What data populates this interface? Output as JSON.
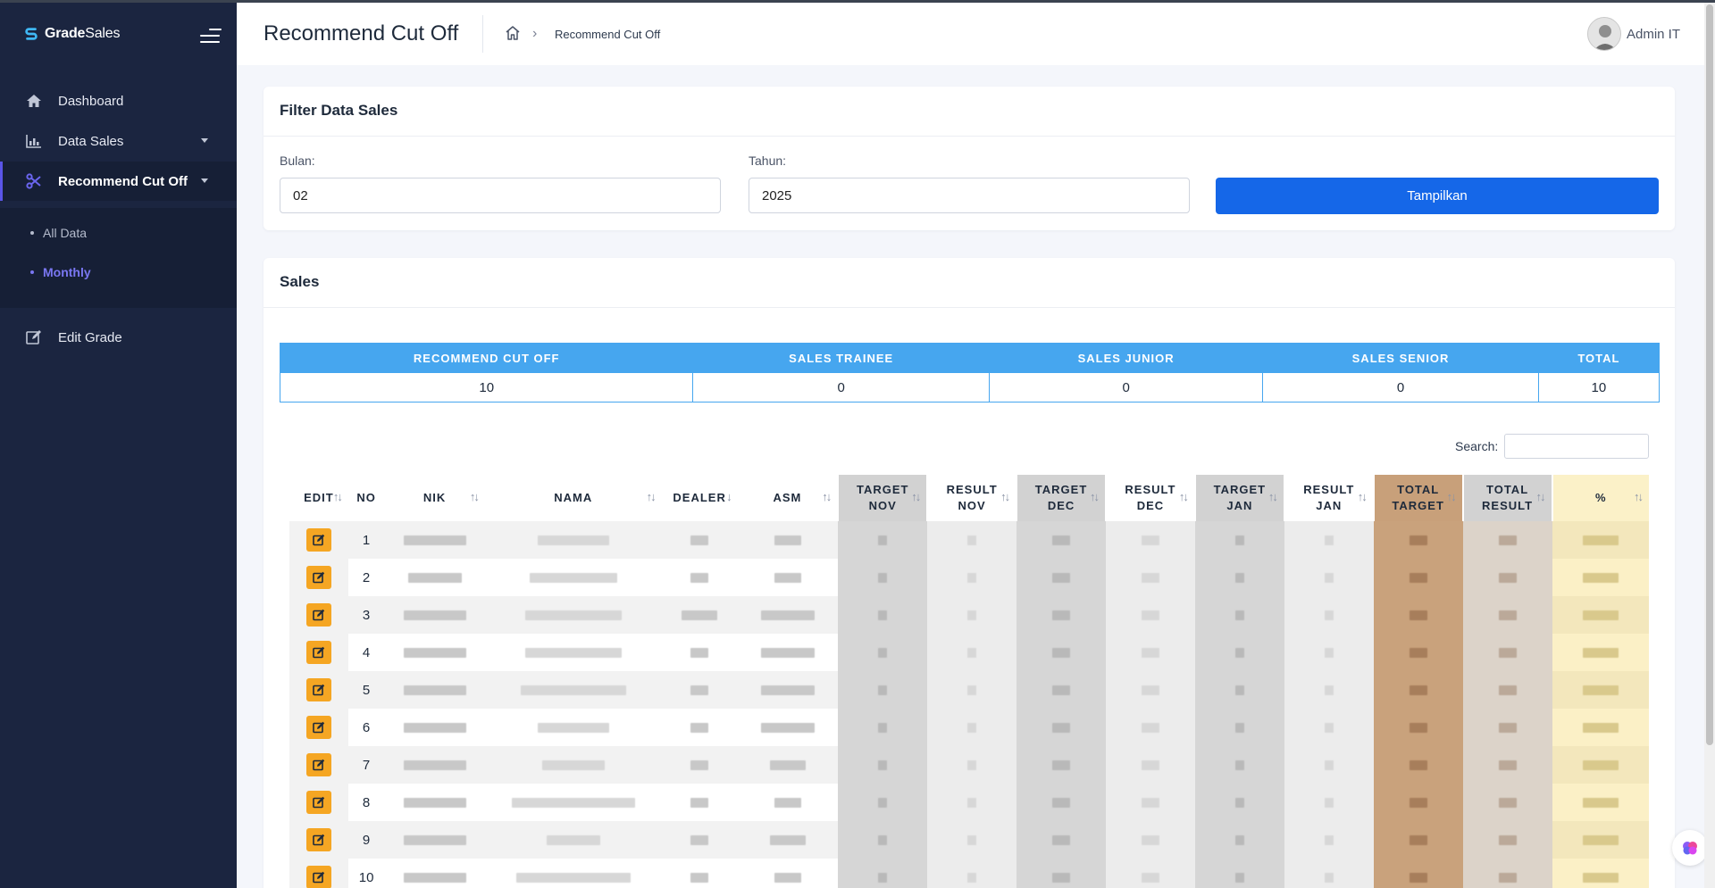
{
  "app": {
    "brand_bold": "Grade",
    "brand_regular": "Sales"
  },
  "sidebar": {
    "items": [
      {
        "label": "Dashboard",
        "icon": "home-icon"
      },
      {
        "label": "Data Sales",
        "icon": "bar-chart-icon"
      },
      {
        "label": "Recommend Cut Off",
        "icon": "scissors-icon",
        "active": true
      },
      {
        "label": "Edit Grade",
        "icon": "edit-icon"
      }
    ],
    "submenu": [
      {
        "label": "All Data"
      },
      {
        "label": "Monthly",
        "active": true
      }
    ]
  },
  "header": {
    "title": "Recommend Cut Off",
    "breadcrumb": "Recommend Cut Off",
    "user": "Admin IT"
  },
  "filter": {
    "title": "Filter Data Sales",
    "bulan_label": "Bulan:",
    "bulan_value": "02",
    "tahun_label": "Tahun:",
    "tahun_value": "2025",
    "button_label": "Tampilkan"
  },
  "sales": {
    "title": "Sales",
    "summary_headers": [
      "RECOMMEND CUT OFF",
      "SALES TRAINEE",
      "SALES JUNIOR",
      "SALES SENIOR",
      "TOTAL"
    ],
    "summary_values": [
      "10",
      "0",
      "0",
      "0",
      "10"
    ],
    "search_label": "Search:",
    "columns": [
      {
        "l1": "EDIT",
        "l2": ""
      },
      {
        "l1": "NO",
        "l2": ""
      },
      {
        "l1": "NIK",
        "l2": ""
      },
      {
        "l1": "NAMA",
        "l2": ""
      },
      {
        "l1": "DEALER",
        "l2": ""
      },
      {
        "l1": "ASM",
        "l2": ""
      },
      {
        "l1": "TARGET",
        "l2": "NOV"
      },
      {
        "l1": "RESULT",
        "l2": "NOV"
      },
      {
        "l1": "TARGET",
        "l2": "DEC"
      },
      {
        "l1": "RESULT",
        "l2": "DEC"
      },
      {
        "l1": "TARGET",
        "l2": "JAN"
      },
      {
        "l1": "RESULT",
        "l2": "JAN"
      },
      {
        "l1": "TOTAL",
        "l2": "TARGET"
      },
      {
        "l1": "TOTAL",
        "l2": "RESULT"
      },
      {
        "l1": "%",
        "l2": ""
      }
    ],
    "row_numbers": [
      "1",
      "2",
      "3",
      "4",
      "5",
      "6",
      "7",
      "8",
      "9",
      "10"
    ]
  },
  "colors": {
    "primary": "#1567e8",
    "summary_header": "#46a6ef",
    "edit_button": "#f5a623",
    "sidebar_bg": "#1b2540",
    "active_accent": "#6b66f0"
  }
}
